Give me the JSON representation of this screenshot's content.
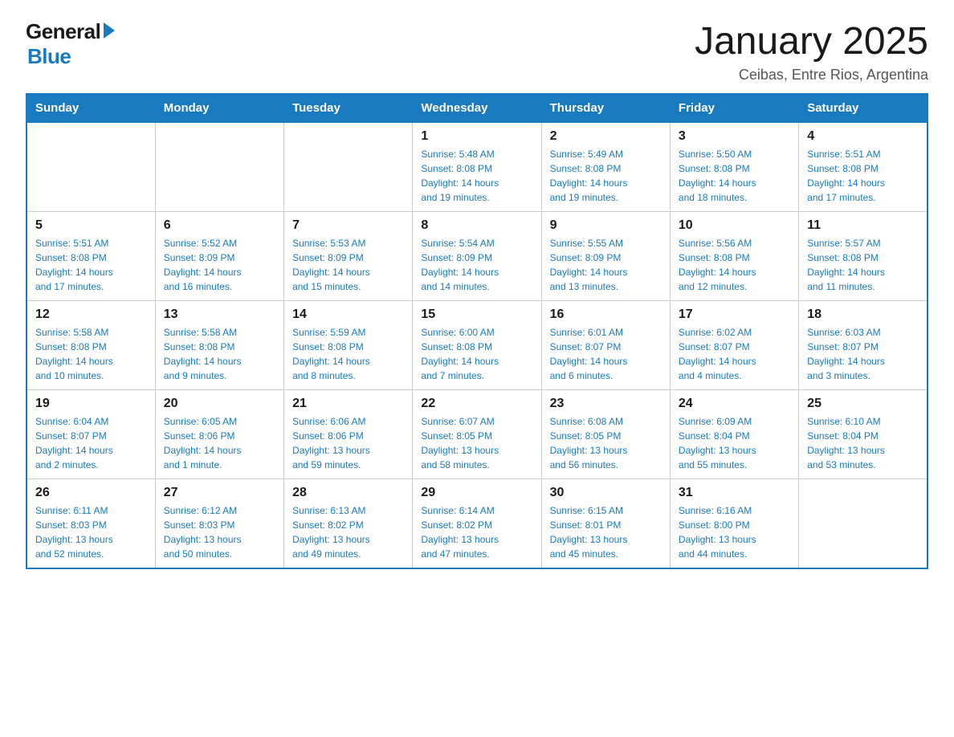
{
  "header": {
    "title": "January 2025",
    "subtitle": "Ceibas, Entre Rios, Argentina"
  },
  "logo": {
    "general": "General",
    "blue": "Blue"
  },
  "days_of_week": [
    "Sunday",
    "Monday",
    "Tuesday",
    "Wednesday",
    "Thursday",
    "Friday",
    "Saturday"
  ],
  "weeks": [
    [
      {
        "day": "",
        "info": ""
      },
      {
        "day": "",
        "info": ""
      },
      {
        "day": "",
        "info": ""
      },
      {
        "day": "1",
        "info": "Sunrise: 5:48 AM\nSunset: 8:08 PM\nDaylight: 14 hours\nand 19 minutes."
      },
      {
        "day": "2",
        "info": "Sunrise: 5:49 AM\nSunset: 8:08 PM\nDaylight: 14 hours\nand 19 minutes."
      },
      {
        "day": "3",
        "info": "Sunrise: 5:50 AM\nSunset: 8:08 PM\nDaylight: 14 hours\nand 18 minutes."
      },
      {
        "day": "4",
        "info": "Sunrise: 5:51 AM\nSunset: 8:08 PM\nDaylight: 14 hours\nand 17 minutes."
      }
    ],
    [
      {
        "day": "5",
        "info": "Sunrise: 5:51 AM\nSunset: 8:08 PM\nDaylight: 14 hours\nand 17 minutes."
      },
      {
        "day": "6",
        "info": "Sunrise: 5:52 AM\nSunset: 8:09 PM\nDaylight: 14 hours\nand 16 minutes."
      },
      {
        "day": "7",
        "info": "Sunrise: 5:53 AM\nSunset: 8:09 PM\nDaylight: 14 hours\nand 15 minutes."
      },
      {
        "day": "8",
        "info": "Sunrise: 5:54 AM\nSunset: 8:09 PM\nDaylight: 14 hours\nand 14 minutes."
      },
      {
        "day": "9",
        "info": "Sunrise: 5:55 AM\nSunset: 8:09 PM\nDaylight: 14 hours\nand 13 minutes."
      },
      {
        "day": "10",
        "info": "Sunrise: 5:56 AM\nSunset: 8:08 PM\nDaylight: 14 hours\nand 12 minutes."
      },
      {
        "day": "11",
        "info": "Sunrise: 5:57 AM\nSunset: 8:08 PM\nDaylight: 14 hours\nand 11 minutes."
      }
    ],
    [
      {
        "day": "12",
        "info": "Sunrise: 5:58 AM\nSunset: 8:08 PM\nDaylight: 14 hours\nand 10 minutes."
      },
      {
        "day": "13",
        "info": "Sunrise: 5:58 AM\nSunset: 8:08 PM\nDaylight: 14 hours\nand 9 minutes."
      },
      {
        "day": "14",
        "info": "Sunrise: 5:59 AM\nSunset: 8:08 PM\nDaylight: 14 hours\nand 8 minutes."
      },
      {
        "day": "15",
        "info": "Sunrise: 6:00 AM\nSunset: 8:08 PM\nDaylight: 14 hours\nand 7 minutes."
      },
      {
        "day": "16",
        "info": "Sunrise: 6:01 AM\nSunset: 8:07 PM\nDaylight: 14 hours\nand 6 minutes."
      },
      {
        "day": "17",
        "info": "Sunrise: 6:02 AM\nSunset: 8:07 PM\nDaylight: 14 hours\nand 4 minutes."
      },
      {
        "day": "18",
        "info": "Sunrise: 6:03 AM\nSunset: 8:07 PM\nDaylight: 14 hours\nand 3 minutes."
      }
    ],
    [
      {
        "day": "19",
        "info": "Sunrise: 6:04 AM\nSunset: 8:07 PM\nDaylight: 14 hours\nand 2 minutes."
      },
      {
        "day": "20",
        "info": "Sunrise: 6:05 AM\nSunset: 8:06 PM\nDaylight: 14 hours\nand 1 minute."
      },
      {
        "day": "21",
        "info": "Sunrise: 6:06 AM\nSunset: 8:06 PM\nDaylight: 13 hours\nand 59 minutes."
      },
      {
        "day": "22",
        "info": "Sunrise: 6:07 AM\nSunset: 8:05 PM\nDaylight: 13 hours\nand 58 minutes."
      },
      {
        "day": "23",
        "info": "Sunrise: 6:08 AM\nSunset: 8:05 PM\nDaylight: 13 hours\nand 56 minutes."
      },
      {
        "day": "24",
        "info": "Sunrise: 6:09 AM\nSunset: 8:04 PM\nDaylight: 13 hours\nand 55 minutes."
      },
      {
        "day": "25",
        "info": "Sunrise: 6:10 AM\nSunset: 8:04 PM\nDaylight: 13 hours\nand 53 minutes."
      }
    ],
    [
      {
        "day": "26",
        "info": "Sunrise: 6:11 AM\nSunset: 8:03 PM\nDaylight: 13 hours\nand 52 minutes."
      },
      {
        "day": "27",
        "info": "Sunrise: 6:12 AM\nSunset: 8:03 PM\nDaylight: 13 hours\nand 50 minutes."
      },
      {
        "day": "28",
        "info": "Sunrise: 6:13 AM\nSunset: 8:02 PM\nDaylight: 13 hours\nand 49 minutes."
      },
      {
        "day": "29",
        "info": "Sunrise: 6:14 AM\nSunset: 8:02 PM\nDaylight: 13 hours\nand 47 minutes."
      },
      {
        "day": "30",
        "info": "Sunrise: 6:15 AM\nSunset: 8:01 PM\nDaylight: 13 hours\nand 45 minutes."
      },
      {
        "day": "31",
        "info": "Sunrise: 6:16 AM\nSunset: 8:00 PM\nDaylight: 13 hours\nand 44 minutes."
      },
      {
        "day": "",
        "info": ""
      }
    ]
  ]
}
